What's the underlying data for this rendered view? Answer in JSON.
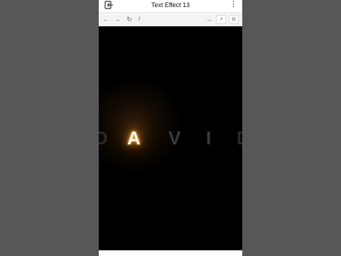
{
  "app": {
    "title": "Text Effect 13",
    "menu_glyph": "⋮",
    "back_icon": "exit-icon"
  },
  "toolbar": {
    "back_glyph": "←",
    "forward_glyph": "→",
    "reload_glyph": "↻",
    "url": "/",
    "go_glyph": "→",
    "pin_glyph": "↗",
    "open_glyph": "⧉"
  },
  "content": {
    "letters": [
      "D",
      "A",
      "V",
      "I",
      "D"
    ],
    "active_letter_index": 1,
    "glow_color": "#ff9a2a",
    "background_color": "#000000"
  }
}
